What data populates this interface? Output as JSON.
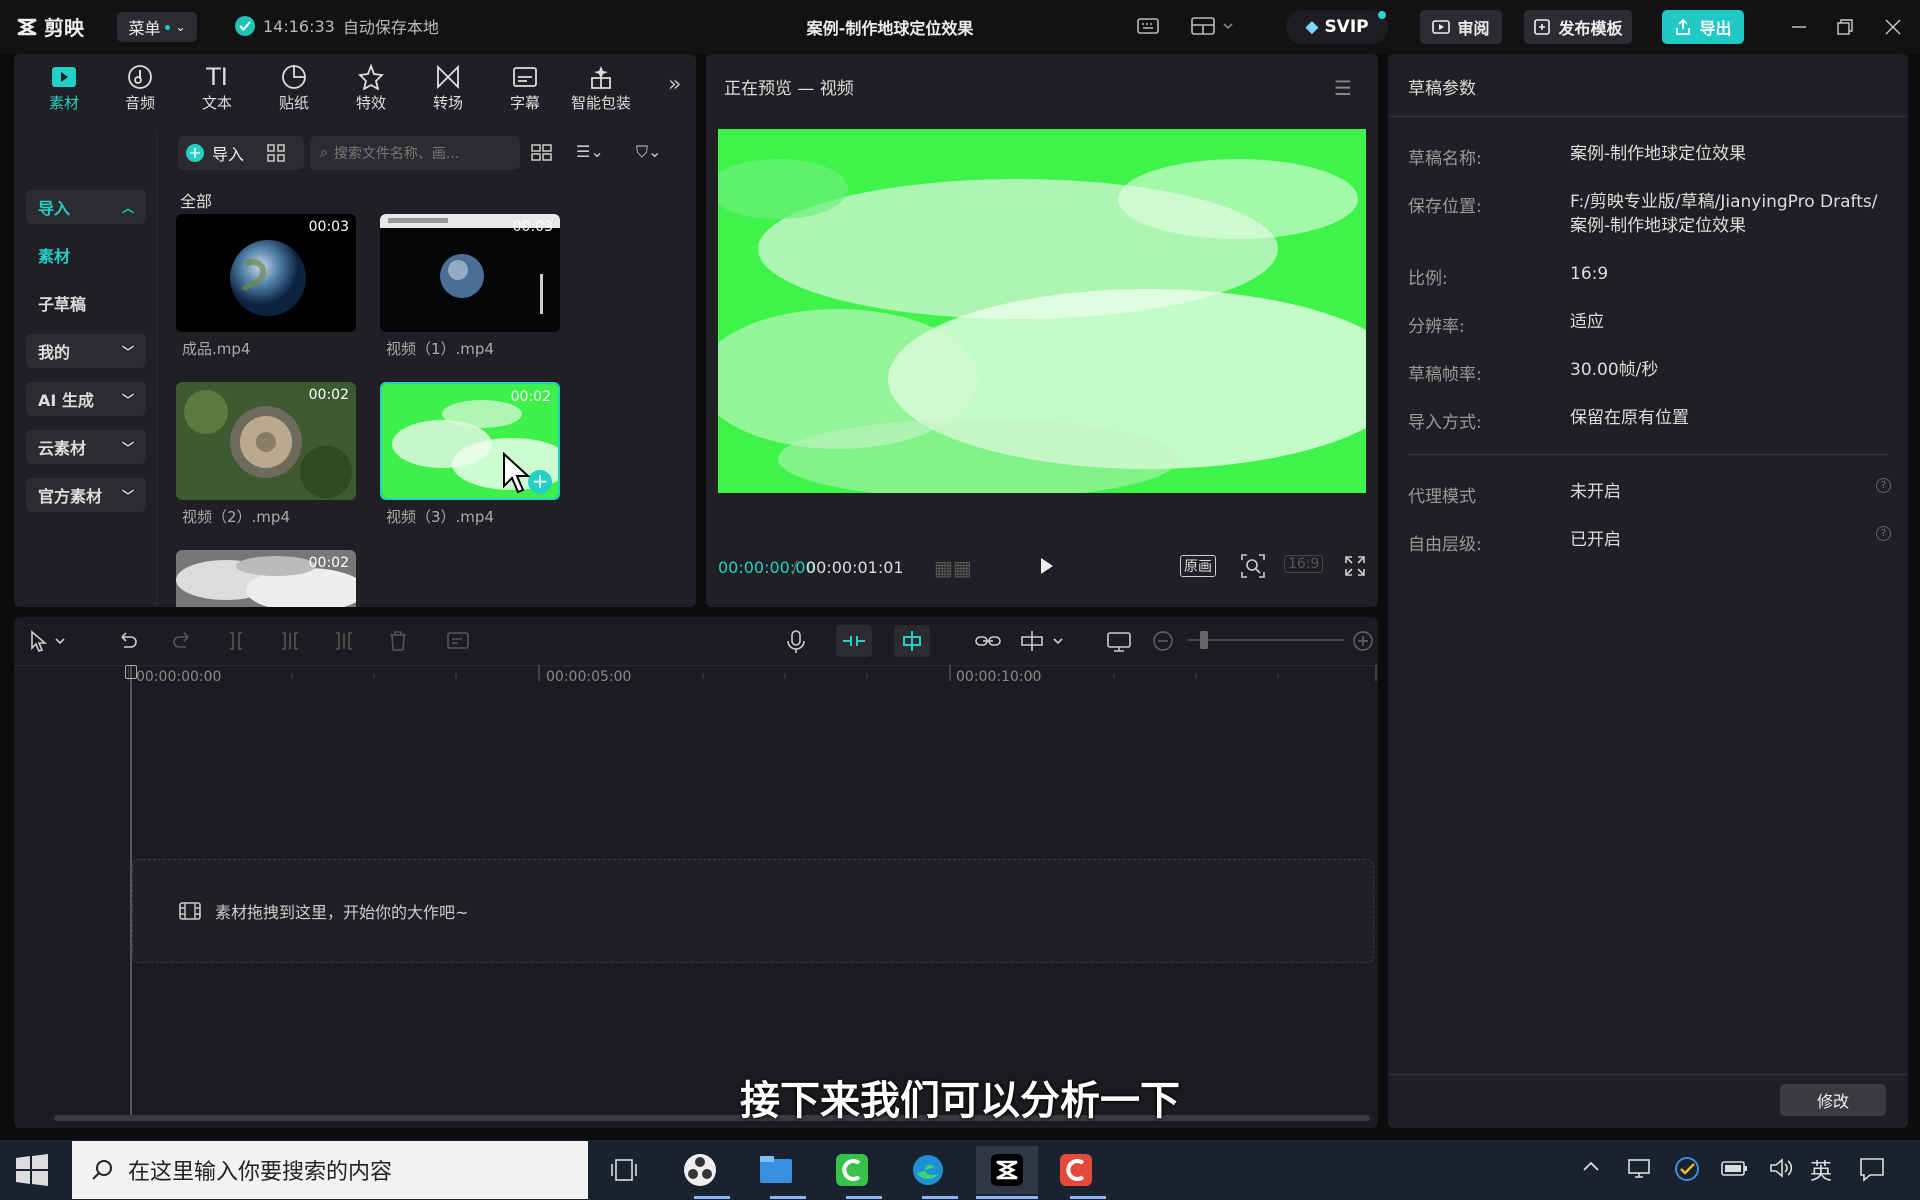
{
  "app": {
    "logo": "剪映",
    "menu": "菜单",
    "save_time": "14:16:33",
    "save_text": "自动保存本地",
    "title": "案例-制作地球定位效果",
    "svip": "SVIP",
    "review": "审阅",
    "publish": "发布模板",
    "export": "导出",
    "accent": "#22d0c6"
  },
  "tools": [
    {
      "label": "素材",
      "icon": "media-icon"
    },
    {
      "label": "音频",
      "icon": "audio-icon"
    },
    {
      "label": "文本",
      "icon": "text-icon"
    },
    {
      "label": "贴纸",
      "icon": "sticker-icon"
    },
    {
      "label": "特效",
      "icon": "effect-icon"
    },
    {
      "label": "转场",
      "icon": "transition-icon"
    },
    {
      "label": "字幕",
      "icon": "caption-icon"
    },
    {
      "label": "智能包装",
      "icon": "smart-pack-icon"
    }
  ],
  "sidebar": [
    {
      "label": "导入"
    },
    {
      "label": "素材"
    },
    {
      "label": "子草稿"
    },
    {
      "label": "我的"
    },
    {
      "label": "AI 生成"
    },
    {
      "label": "云素材"
    },
    {
      "label": "官方素材"
    }
  ],
  "media": {
    "import": "导入",
    "search_placeholder": "搜索文件名称、画...",
    "all": "全部",
    "items": [
      {
        "name": "成品.mp4",
        "dur": "00:03"
      },
      {
        "name": "视频（1）.mp4",
        "dur": "00:03"
      },
      {
        "name": "视频（2）.mp4",
        "dur": "00:02"
      },
      {
        "name": "视频（3）.mp4",
        "dur": "00:02"
      },
      {
        "name": "",
        "dur": "00:02"
      }
    ]
  },
  "preview": {
    "title": "正在预览 — 视频",
    "current": "00:00:00:00",
    "sep": "/",
    "total": "00:00:01:01",
    "orig": "原画",
    "ratio": "16:9"
  },
  "params": {
    "header": "草稿参数",
    "rows": [
      {
        "k": "草稿名称:",
        "v": "案例-制作地球定位效果"
      },
      {
        "k": "保存位置:",
        "v": "F:/剪映专业版/草稿/JianyingPro Drafts/案例-制作地球定位效果"
      },
      {
        "k": "比例:",
        "v": "16:9"
      },
      {
        "k": "分辨率:",
        "v": "适应"
      },
      {
        "k": "草稿帧率:",
        "v": "30.00帧/秒"
      },
      {
        "k": "导入方式:",
        "v": "保留在原有位置"
      },
      {
        "k": "代理模式",
        "v": "未开启"
      },
      {
        "k": "自由层级:",
        "v": "已开启"
      }
    ],
    "edit": "修改"
  },
  "timeline": {
    "ruler": [
      "00:00:00:00",
      "00:00:05:00",
      "00:00:10:00"
    ],
    "drop": "素材拖拽到这里，开始你的大作吧~"
  },
  "subtitle": "接下来我们可以分析一下",
  "taskbar": {
    "search": "在这里输入你要搜索的内容",
    "ime": "英"
  }
}
